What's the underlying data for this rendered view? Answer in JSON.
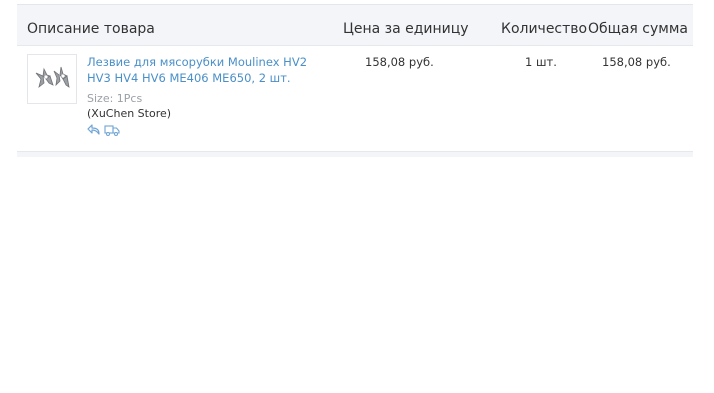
{
  "table": {
    "headers": {
      "description": "Описание товара",
      "unit_price": "Цена за единицу",
      "quantity": "Количество",
      "total": "Общая сумма"
    },
    "rows": [
      {
        "title": "Лезвие для мясорубки Moulinex HV2 HV3 HV4 HV6 ME406 ME650, 2 шт.",
        "size": "Size: 1Pcs",
        "store": "(XuChen Store)",
        "unit_price": "158,08 руб.",
        "quantity": "1 шт.",
        "total": "158,08 руб.",
        "icons": [
          "return-arrow-icon",
          "delivery-truck-icon"
        ]
      }
    ]
  },
  "colors": {
    "link": "#4a8fc8",
    "text": "#333333",
    "muted": "#9aa0a6",
    "header_bg": "#f3f5f8"
  }
}
